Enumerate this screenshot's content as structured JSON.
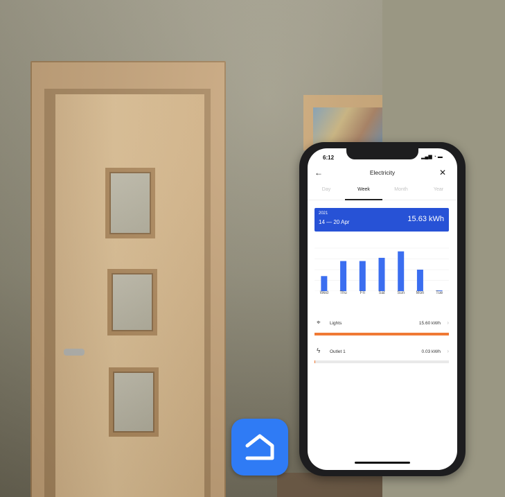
{
  "phone": {
    "status_time": "6:12",
    "status_icons": "▂▄▆ ◔ ▬",
    "header": {
      "back": "←",
      "title": "Electricity",
      "close": "✕"
    },
    "tabs": [
      {
        "label": "Day",
        "active": false
      },
      {
        "label": "Week",
        "active": true
      },
      {
        "label": "Month",
        "active": false
      },
      {
        "label": "Year",
        "active": false
      }
    ],
    "summary": {
      "year": "2021",
      "range": "14 — 20 Apr",
      "total": "15.63 kWh"
    },
    "devices": [
      {
        "name": "Lights",
        "value": "15.60 kWh",
        "icon": "lightbulb-icon",
        "glyph": "⌖",
        "share": 0.998,
        "color": "#f07a35"
      },
      {
        "name": "Outlet 1",
        "value": "0.03 kWh",
        "icon": "bolt-icon",
        "glyph": "ϟ",
        "share": 0.002,
        "color": "#f07a35"
      }
    ],
    "chevron": "›"
  },
  "chart_data": {
    "type": "bar",
    "categories": [
      "Wed",
      "Thu",
      "Fri",
      "Sat",
      "Sun",
      "Mon",
      "Tue"
    ],
    "values": [
      1.4,
      2.8,
      2.8,
      3.1,
      3.7,
      2.0,
      0.05
    ],
    "ylim": [
      0,
      4
    ],
    "grid": true,
    "bar_color": "#3b6ef0"
  },
  "colors": {
    "accent": "#2752d6",
    "app_icon": "#2f7bf5",
    "usage_bar": "#f07a35"
  }
}
